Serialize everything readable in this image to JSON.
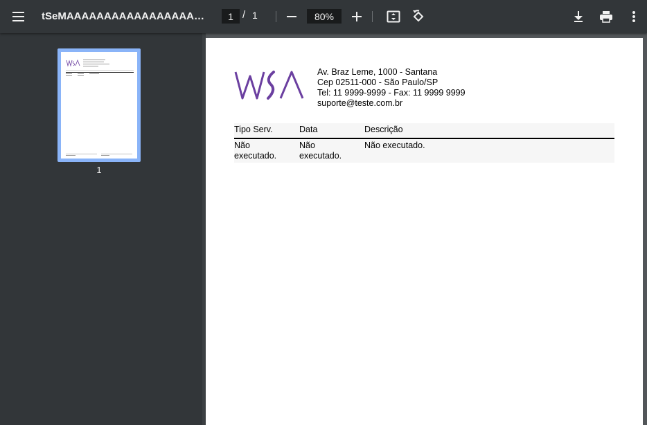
{
  "toolbar": {
    "title": "tSeMAAAAAAAAAAAAAAAAAAAAAA",
    "page_current": "1",
    "page_separator": "/",
    "page_total": "1",
    "zoom": "80%"
  },
  "sidebar": {
    "thumbnail_page_number": "1"
  },
  "document": {
    "logo_text": "WSA",
    "address_lines": [
      "Av. Braz Leme, 1000 - Santana",
      "Cep 02511-000 - São Paulo/SP",
      "Tel: 11 9999-9999 - Fax: 11 9999 9999",
      "suporte@teste.com.br"
    ],
    "table": {
      "headers": [
        "Tipo Serv.",
        "Data",
        "Descrição"
      ],
      "rows": [
        [
          "Não executado.",
          "Não executado.",
          "Não executado."
        ]
      ]
    }
  },
  "colors": {
    "toolbar_bg": "#323639",
    "viewer_bg": "#525659",
    "thumbnail_highlight": "#8ab4f8",
    "logo_purple": "#6b3fa0"
  }
}
